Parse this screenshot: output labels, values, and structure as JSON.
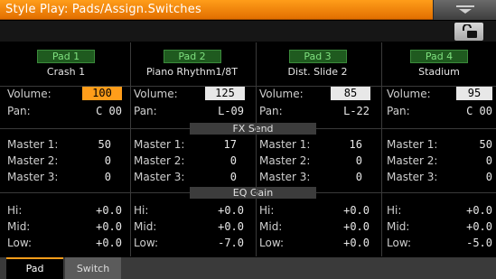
{
  "title": "Style Play: Pads/Assign.Switches",
  "sections": {
    "fx_send": "FX Send",
    "eq_gain": "EQ Gain"
  },
  "labels": {
    "volume": "Volume:",
    "pan": "Pan:",
    "master1": "Master 1:",
    "master2": "Master 2:",
    "master3": "Master 3:",
    "hi": "Hi:",
    "mid": "Mid:",
    "low": "Low:"
  },
  "pads": [
    {
      "name": "Pad 1",
      "sound": "Crash 1",
      "volume": "100",
      "volume_selected": true,
      "pan": "C 00",
      "master1": "50",
      "master2": "0",
      "master3": "0",
      "hi": "+0.0",
      "mid": "+0.0",
      "low": "+0.0"
    },
    {
      "name": "Pad 2",
      "sound": "Piano Rhythm1/8T",
      "volume": "125",
      "volume_selected": false,
      "pan": "L-09",
      "master1": "17",
      "master2": "0",
      "master3": "0",
      "hi": "+0.0",
      "mid": "+0.0",
      "low": "-7.0"
    },
    {
      "name": "Pad 3",
      "sound": "Dist. Slide 2",
      "volume": "85",
      "volume_selected": false,
      "pan": "L-22",
      "master1": "16",
      "master2": "0",
      "master3": "0",
      "hi": "+0.0",
      "mid": "+0.0",
      "low": "+0.0"
    },
    {
      "name": "Pad 4",
      "sound": "Stadium",
      "volume": "95",
      "volume_selected": false,
      "pan": "C 00",
      "master1": "50",
      "master2": "0",
      "master3": "0",
      "hi": "+0.0",
      "mid": "+0.0",
      "low": "-5.0"
    }
  ],
  "tabs": [
    {
      "label": "Pad",
      "active": true
    },
    {
      "label": "Switch",
      "active": false
    }
  ],
  "icons": {
    "menu": "chevron-down-icon",
    "lock": "lock-icon"
  },
  "colors": {
    "accent": "#ff9d1a",
    "pad_green": "#7fe07f"
  }
}
